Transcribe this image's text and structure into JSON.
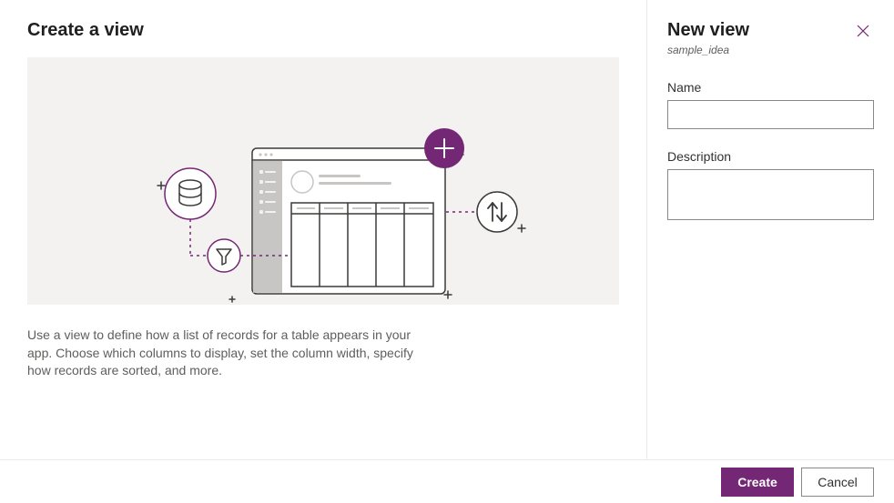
{
  "left": {
    "title": "Create a view",
    "description": "Use a view to define how a list of records for a table appears in your app. Choose which columns to display, set the column width, specify how records are sorted, and more."
  },
  "right": {
    "title": "New view",
    "entity": "sample_idea",
    "fields": {
      "name_label": "Name",
      "name_value": "",
      "description_label": "Description",
      "description_value": ""
    }
  },
  "footer": {
    "create": "Create",
    "cancel": "Cancel"
  },
  "colors": {
    "accent": "#742774"
  }
}
